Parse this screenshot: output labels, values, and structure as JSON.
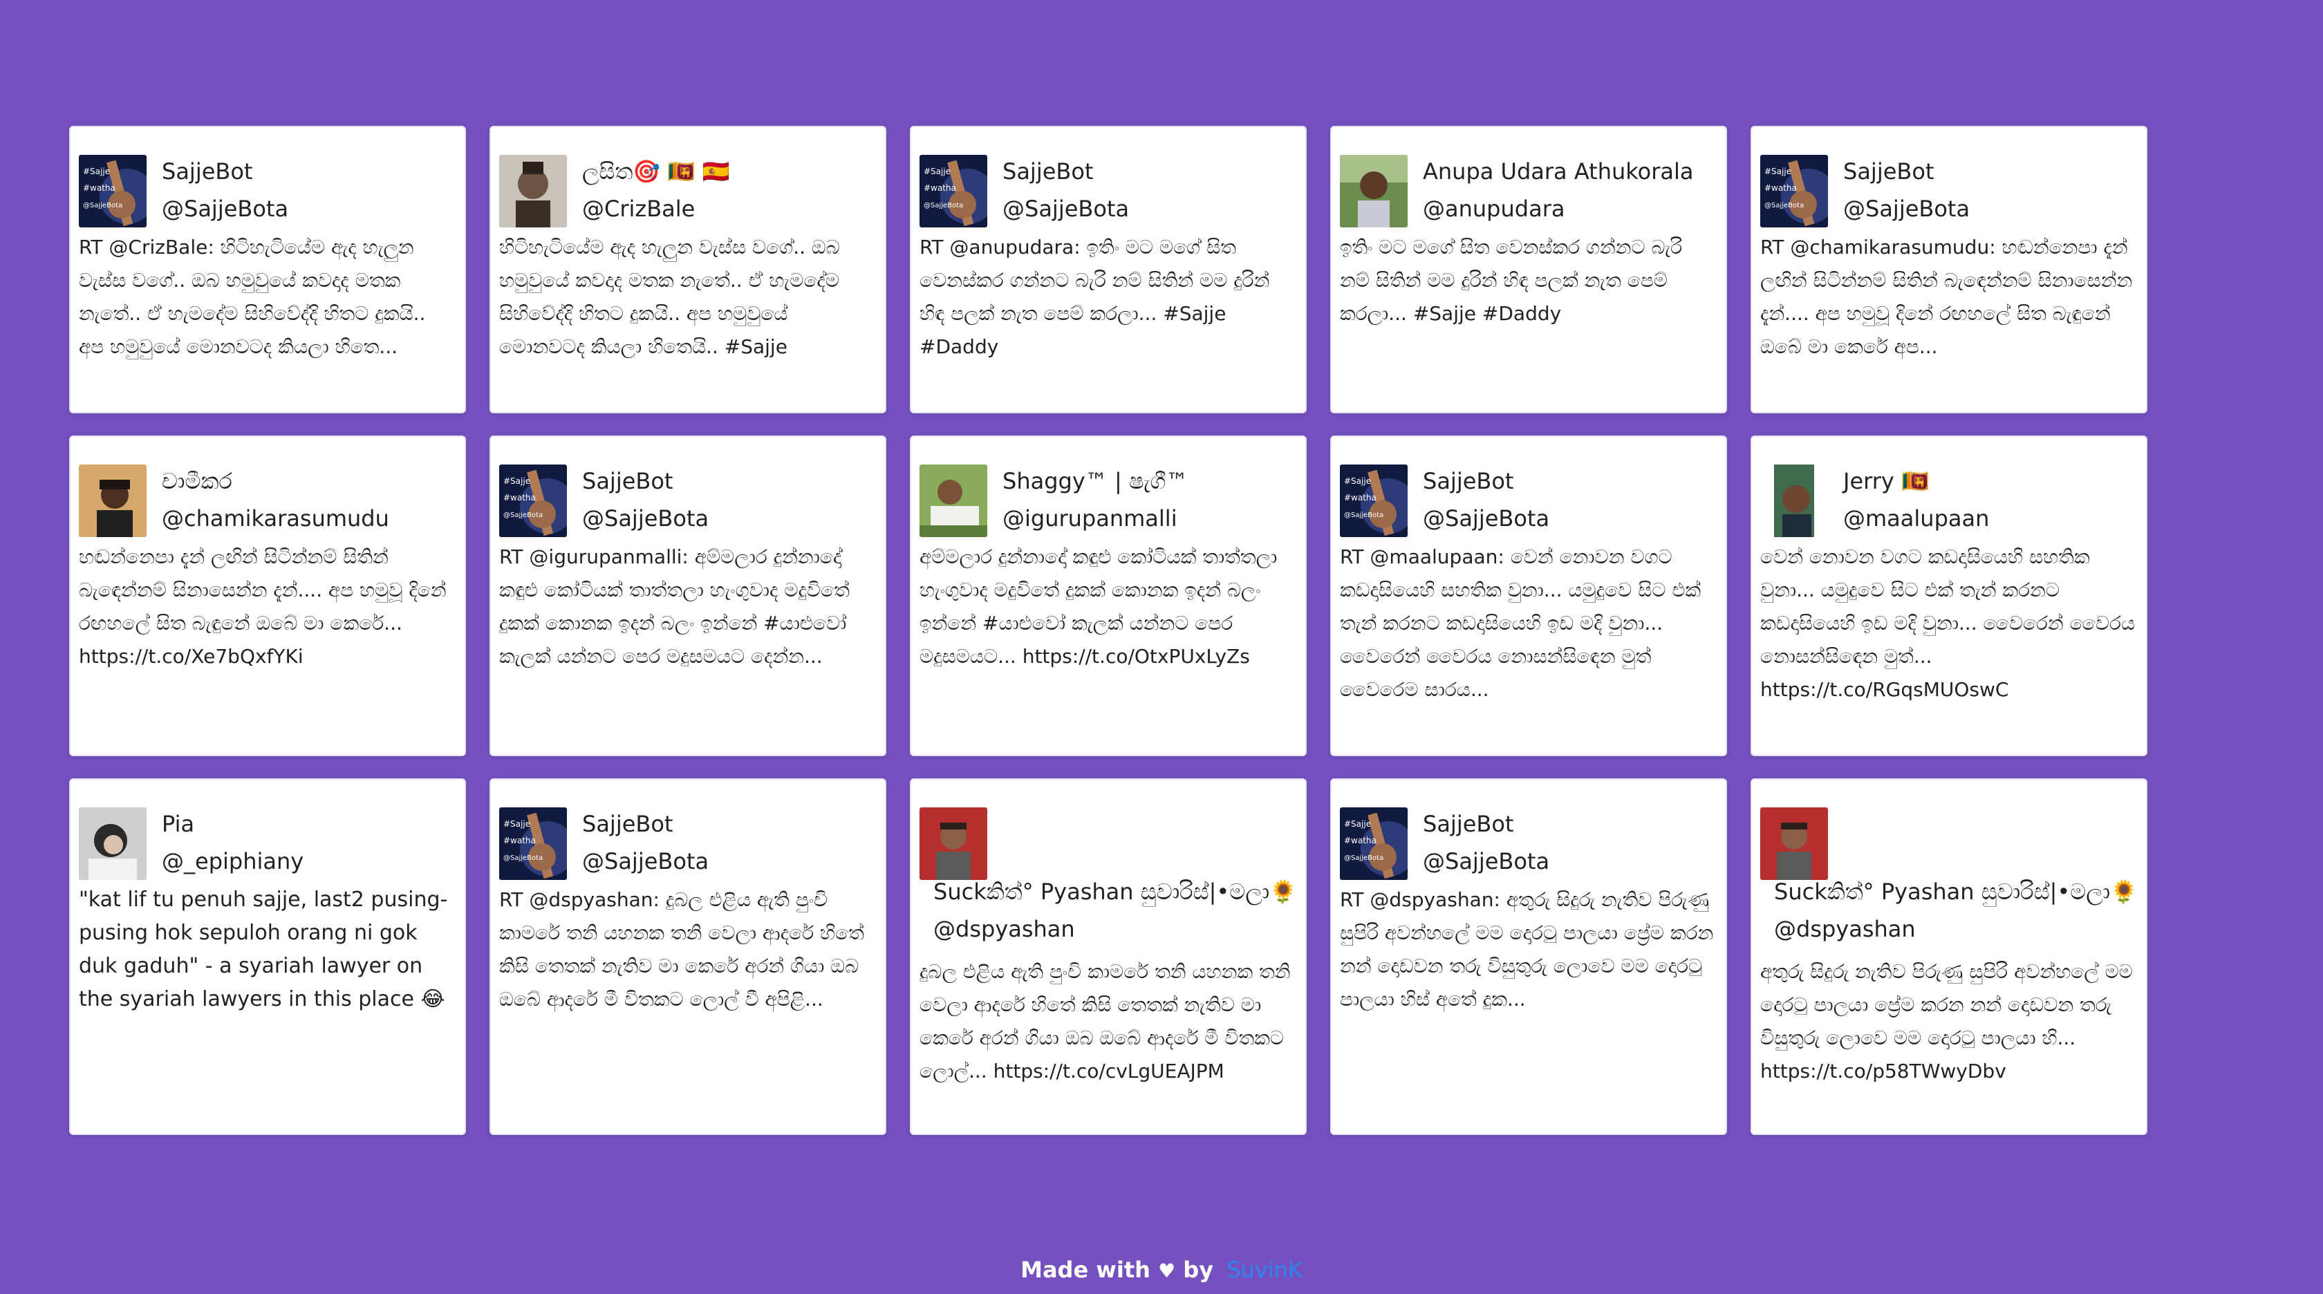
{
  "accent_color": "#7451be",
  "link_color": "#2b86f0",
  "tweets": [
    {
      "name": "SajjeBot",
      "handle": "@SajjeBota",
      "avatar": "bot-guitar-avatar",
      "text": "RT @CrizBale: හිටිහැටියේම ඇද හැලුන වැස්ස වගේ.. ඔබ හමුවුයේ කවදාද මතක නැතේ.. ඒ හැමදේම සිහිවේද්දි හිතට දුකයි.. අප හමුවුයේ මොනවටද කියලා හිතෙ..."
    },
    {
      "name": "ලසිත🎯 🇱🇰 🇪🇸",
      "handle": "@CrizBale",
      "avatar": "man-portrait-avatar",
      "text": "හිටිහැටියේම ඇද හැලුන වැස්ස වගේ.. ඔබ හමුවුයේ කවදාද මතක නැතේ.. ඒ හැමදේම සිහිවේද්දි හිතට දුකයි.. අප හමුවුයේ මොනවටද කියලා හිතෙයි.. #Sajje"
    },
    {
      "name": "SajjeBot",
      "handle": "@SajjeBota",
      "avatar": "bot-guitar-avatar",
      "text": "RT @anupudara: ඉතිං මට මගේ සිත වෙනස්කර ගන්නට බැරි නම් සිතින් මම දුරින් හිඳ පලක් නැත පෙම් කරලා... #Sajje #Daddy"
    },
    {
      "name": "Anupa Udara Athukorala",
      "handle": "@anupudara",
      "avatar": "man-outdoor-avatar",
      "text": "ඉතිං මට මගේ සිත වෙනස්කර ගන්නට බැරි නම් සිතින් මම දුරින් හිඳ පලක් නැත පෙම් කරලා... #Sajje #Daddy"
    },
    {
      "name": "SajjeBot",
      "handle": "@SajjeBota",
      "avatar": "bot-guitar-avatar",
      "text": "RT @chamikarasumudu: හඬන්නෙපා දැන් ලඟින් සිටින්නම් සිතින් බැඳෙන්නම් සිනාසෙන්න දැන්.... අප හමුවූ දිනේ රඟහලේ සිත බැඳුනේ ඔබේ මා කෙරේ අප..."
    },
    {
      "name": "චාමීකර",
      "handle": "@chamikarasumudu",
      "avatar": "man-casual-avatar",
      "text": "හඬන්නෙපා දැන් ලඟින් සිටින්නම් සිතින් බැඳෙන්නම් සිනාසෙන්න දැන්.... අප හමුවූ දිනේ රඟහලේ සිත බැඳුනේ ඔබේ මා කෙරේ... https://t.co/Xe7bQxfYKi"
    },
    {
      "name": "SajjeBot",
      "handle": "@SajjeBota",
      "avatar": "bot-guitar-avatar",
      "text": "RT @igurupanmalli: අම්මලාර දුන්නාදෝ කඳුළු කෝටියක් තාත්තලා හැංගුවාද මදුවිතේ දුකක් කොනක ඉදන් බලං ඉන්නේ #යාළුවෝ කැලක් යන්නට පෙර මදුසමයට දෙන්න..."
    },
    {
      "name": "Shaggy™ | ෂැගී™",
      "handle": "@igurupanmalli",
      "avatar": "man-grass-avatar",
      "text": "අම්මලාර දුන්නාදෝ කඳුළු කෝටියක් තාත්තලා හැංගුවාද මදුවිතේ දුකක් කොනක ඉදන් බලං ඉන්නේ #යාළුවෝ කැලක් යන්නට පෙර මදුසමයට... https://t.co/OtxPUxLyZs"
    },
    {
      "name": "SajjeBot",
      "handle": "@SajjeBota",
      "avatar": "bot-guitar-avatar",
      "text": "RT @maalupaan: වෙන් නොවන වගට කඩදාසියෙහි සහතික වුනා... යමුදුවෙ සිට එක් තැන් කරනට කඩදාසියෙහි ඉඩ මදි වුනා... වෛරෙන් වෛරය නොසන්සිඳෙන මුත් වෛරෙම සාරය..."
    },
    {
      "name": "Jerry 🇱🇰",
      "handle": "@maalupaan",
      "avatar": "man-smile-avatar",
      "text": "වෙන් නොවන වගට කඩදාසියෙහි සහතික වුනා... යමුදුවෙ සිට එක් තැන් කරනට කඩදාසියෙහි ඉඩ මදි වුනා... වෛරෙන් වෛරය නොසන්සිඳෙන මුත්... https://t.co/RGqsMUOswC"
    },
    {
      "name": "Pia",
      "handle": "@_epiphiany",
      "avatar": "woman-avatar",
      "text": "\"kat lif tu penuh sajje, last2 pusing-pusing hok sepuloh orang ni gok duk gaduh\" - a syariah lawyer on the syariah lawyers in this place 😂"
    },
    {
      "name": "SajjeBot",
      "handle": "@SajjeBota",
      "avatar": "bot-guitar-avatar",
      "text": "RT @dspyashan: දුබල එළිය ඇති පුංචි කාමරේ තනි යහනක තනි වෙලා ආදරේ හිතේ කිසි තෙතක් නැතිව මා කෙරේ අරන් ගියා ඔබ ඔබේ ආදරේ මී විතකට ලොල් වී අපිළි..."
    },
    {
      "name": "Suckකිත්° Pyashan සුවාරිස්|•මලා🌻",
      "handle": "@dspyashan",
      "avatar": "man-red-avatar",
      "text": "දුබල එළිය ඇති පුංචි කාමරේ තනි යහනක තනි වෙලා ආදරේ හිතේ කිසි තෙතක් නැතිව මා කෙරේ අරන් ගියා ඔබ ඔබේ ආදරේ මී විතකට ලොල්... https://t.co/cvLgUEAJPM"
    },
    {
      "name": "SajjeBot",
      "handle": "@SajjeBota",
      "avatar": "bot-guitar-avatar",
      "text": "RT @dspyashan: අතුරු සිදුරු නැතිව පිරුණු සුපිරි අවන්හලේ මම දොරටු පාලයා ප්‍රේම කරන නන් දොඩවන තරු විසුතුරු ලොවෙ මම දොරටු පාලයා හිස් අතේ දුක..."
    },
    {
      "name": "Suckකිත්° Pyashan සුවාරිස්|•මලා🌻",
      "handle": "@dspyashan",
      "avatar": "man-red-avatar",
      "text": "අතුරු සිදුරු නැතිව පිරුණු සුපිරි අවන්හලේ මම දොරටු පාලයා ප්‍රේම කරන නන් දොඩවන තරු විසුතුරු ලොවෙ මම දොරටු පාලයා හි... https://t.co/p58TWwyDbv"
    }
  ],
  "footer": {
    "made_with": "Made with",
    "heart": "♥",
    "by": "by",
    "author": "SuvinK"
  }
}
